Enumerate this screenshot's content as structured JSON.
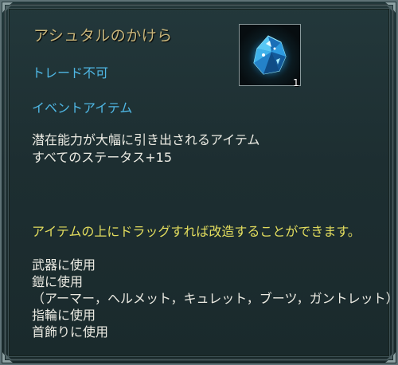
{
  "item": {
    "name": "アシュタルのかけら",
    "trade_status": "トレード不可",
    "category": "イベントアイテム",
    "description": [
      "潜在能力が大幅に引き出されるアイテム",
      "すべてのステータス+15"
    ],
    "drag_note": "アイテムの上にドラッグすれば改造することができます。",
    "usage": [
      "武器に使用",
      "鎧に使用",
      "（アーマー，ヘルメット，キュレット，ブーツ，ガントレット）",
      "指輪に使用",
      "首飾りに使用"
    ],
    "quantity": "1",
    "icon": "blue-crystal-shard-icon"
  },
  "colors": {
    "title": "#c8b57a",
    "info": "#4fb7e4",
    "body": "#ecebe3",
    "note": "#e3dd5e",
    "panel": "#1d2e31",
    "border": "#5f7377"
  }
}
